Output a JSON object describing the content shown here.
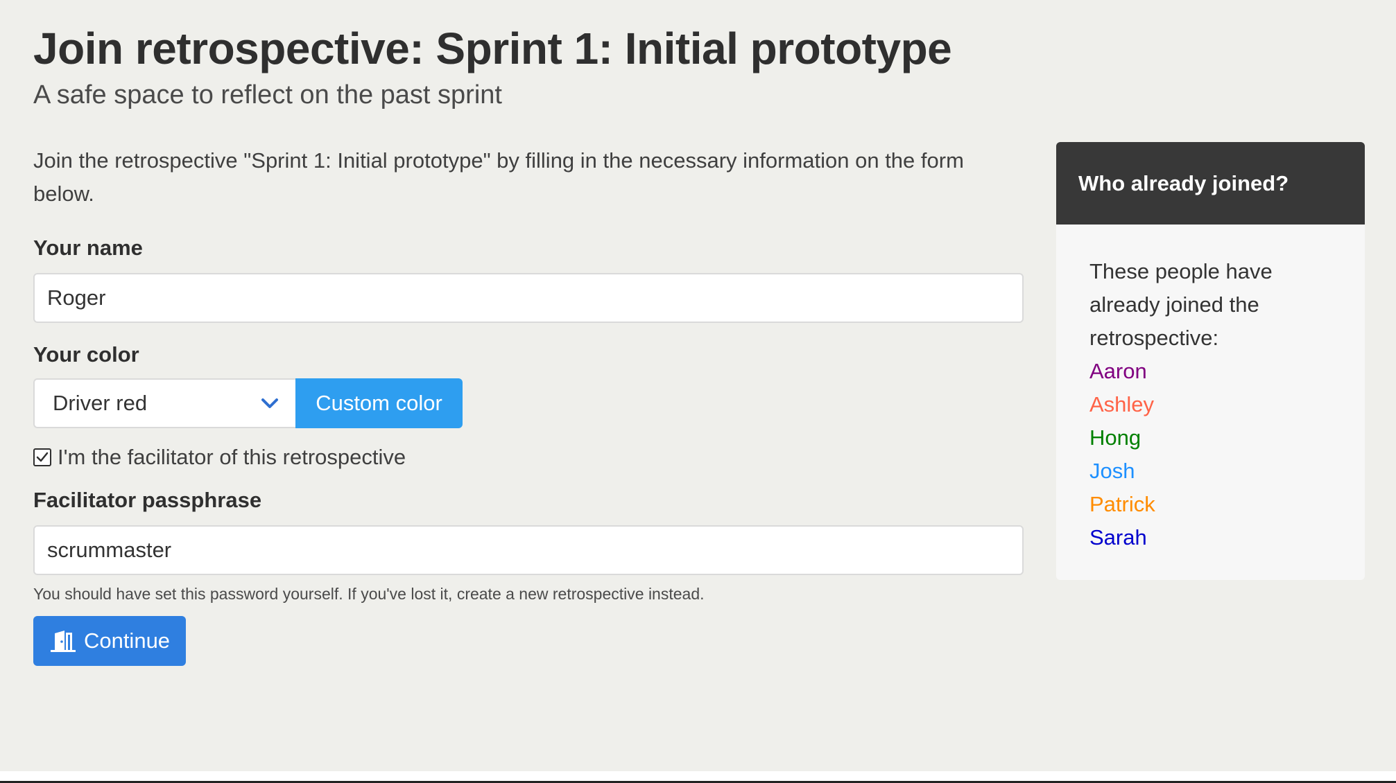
{
  "header": {
    "title": "Join retrospective: Sprint 1: Initial prototype",
    "subtitle": "A safe space to reflect on the past sprint"
  },
  "form": {
    "intro": "Join the retrospective \"Sprint 1: Initial prototype\" by filling in the necessary information on the form below.",
    "name_label": "Your name",
    "name_value": "Roger",
    "color_label": "Your color",
    "color_selected": "Driver red",
    "custom_color_label": "Custom color",
    "facilitator_checkbox_label": "I'm the facilitator of this retrospective",
    "facilitator_checked": true,
    "passphrase_label": "Facilitator passphrase",
    "passphrase_value": "scrummaster",
    "passphrase_help": "You should have set this password yourself. If you've lost it, create a new retrospective instead.",
    "continue_label": "Continue",
    "continue_icon": "door-open-icon"
  },
  "sidebar": {
    "title": "Who already joined?",
    "description": "These people have already joined the retrospective:",
    "participants": [
      {
        "name": "Aaron",
        "color": "#800080"
      },
      {
        "name": "Ashley",
        "color": "#ff6347"
      },
      {
        "name": "Hong",
        "color": "#008000"
      },
      {
        "name": "Josh",
        "color": "#1e90ff"
      },
      {
        "name": "Patrick",
        "color": "#ff8c00"
      },
      {
        "name": "Sarah",
        "color": "#0000cd"
      }
    ]
  },
  "colors": {
    "background": "#efefeb",
    "primary_button": "#2f7fe0",
    "custom_color_button": "#2e9ef0",
    "sidebar_header": "#383838"
  }
}
